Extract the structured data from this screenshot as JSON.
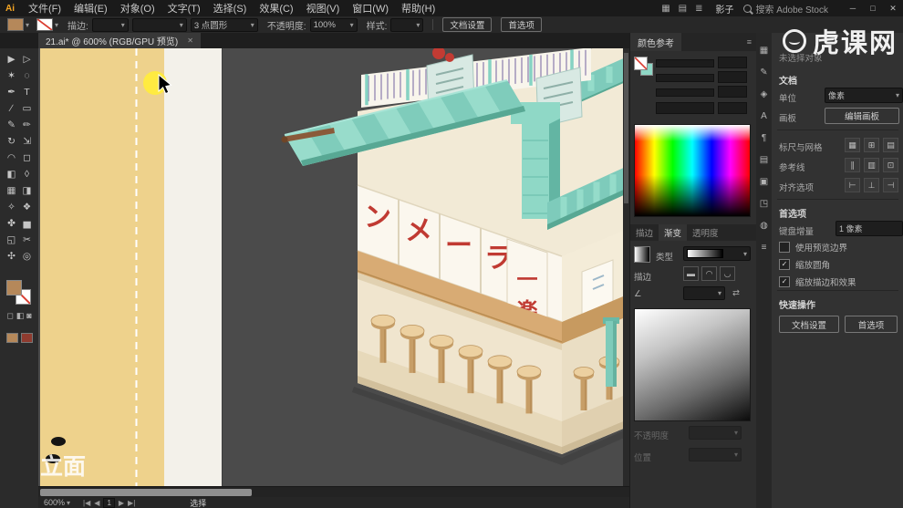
{
  "titlebar": {
    "app_logo": "Ai",
    "user": "影子",
    "search": "搜索 Adobe Stock",
    "window_controls": [
      "─",
      "□",
      "✕"
    ]
  },
  "menubar_icons": [
    {
      "name": "bridge-icon",
      "glyph": "▦"
    },
    {
      "name": "arrange-documents-icon",
      "glyph": "▤"
    },
    {
      "name": "workspace-switcher-icon",
      "glyph": "≣"
    }
  ],
  "menus": [
    "文件(F)",
    "编辑(E)",
    "对象(O)",
    "文字(T)",
    "选择(S)",
    "效果(C)",
    "视图(V)",
    "窗口(W)",
    "帮助(H)"
  ],
  "options": {
    "stroke_label": "描边:",
    "brush_value": "3 点圆形",
    "opacity_label": "不透明度:",
    "opacity_value": "100%",
    "style_label": "样式:",
    "doc_setup": "文档设置",
    "preferences": "首选项"
  },
  "doc_tab": {
    "title": "21.ai* @ 600% (RGB/GPU 预览)",
    "close": "✕"
  },
  "tools": [
    {
      "name": "selection-tool",
      "glyph": "▶"
    },
    {
      "name": "direct-selection-tool",
      "glyph": "▷"
    },
    {
      "name": "magic-wand-tool",
      "glyph": "✶"
    },
    {
      "name": "lasso-tool",
      "glyph": "◌"
    },
    {
      "name": "pen-tool",
      "glyph": "✒"
    },
    {
      "name": "type-tool",
      "glyph": "T"
    },
    {
      "name": "line-segment-tool",
      "glyph": "∕"
    },
    {
      "name": "rectangle-tool",
      "glyph": "▭"
    },
    {
      "name": "paintbrush-tool",
      "glyph": "✎"
    },
    {
      "name": "pencil-tool",
      "glyph": "✏"
    },
    {
      "name": "rotate-tool",
      "glyph": "↻"
    },
    {
      "name": "scale-tool",
      "glyph": "⇲"
    },
    {
      "name": "width-tool",
      "glyph": "◠"
    },
    {
      "name": "free-transform-tool",
      "glyph": "◻"
    },
    {
      "name": "shape-builder-tool",
      "glyph": "◧"
    },
    {
      "name": "perspective-grid-tool",
      "glyph": "◊"
    },
    {
      "name": "mesh-tool",
      "glyph": "▦"
    },
    {
      "name": "gradient-tool",
      "glyph": "◨"
    },
    {
      "name": "eyedropper-tool",
      "glyph": "✧"
    },
    {
      "name": "blend-tool",
      "glyph": "❖"
    },
    {
      "name": "symbol-sprayer-tool",
      "glyph": "✤"
    },
    {
      "name": "column-graph-tool",
      "glyph": "▅"
    },
    {
      "name": "artboard-tool",
      "glyph": "◱"
    },
    {
      "name": "slice-tool",
      "glyph": "✂"
    },
    {
      "name": "hand-tool",
      "glyph": "✣"
    },
    {
      "name": "zoom-tool",
      "glyph": "◎"
    }
  ],
  "toolbar_extra": [
    {
      "name": "draw-normal-mode-icon",
      "glyph": "◻"
    },
    {
      "name": "draw-behind-mode-icon",
      "glyph": "◧"
    },
    {
      "name": "screen-mode-icon",
      "glyph": "◙"
    }
  ],
  "canvas": {
    "signs": [
      "ン",
      "メ",
      "ー",
      "ラ"
    ],
    "corner_sign": [
      "一",
      "楽"
    ],
    "overlay_label": "立面"
  },
  "statusbar": {
    "zoom": "600%",
    "nav": [
      "|◀",
      "◀",
      "1",
      "▶",
      "▶|"
    ],
    "tool": "选择"
  },
  "color_panel": {
    "tab": "颜色参考"
  },
  "gradient_panel": {
    "tabs": [
      "描边",
      "渐变",
      "透明度"
    ],
    "type_label": "类型",
    "stroke_label": "描边",
    "stroke_icons": [
      {
        "name": "gradient-within-stroke-icon",
        "glyph": "▬"
      },
      {
        "name": "gradient-along-stroke-icon",
        "glyph": "◠"
      },
      {
        "name": "gradient-across-stroke-icon",
        "glyph": "◡"
      }
    ],
    "opacity_label": "不透明度",
    "location_label": "位置"
  },
  "dock_icons": [
    {
      "name": "swatches-panel-icon",
      "glyph": "▦"
    },
    {
      "name": "brushes-panel-icon",
      "glyph": "✎"
    },
    {
      "name": "symbols-panel-icon",
      "glyph": "◈"
    },
    {
      "name": "character-panel-icon",
      "glyph": "A"
    },
    {
      "name": "paragraph-panel-icon",
      "glyph": "¶"
    },
    {
      "name": "layers-panel-icon",
      "glyph": "▤"
    },
    {
      "name": "artboards-panel-icon",
      "glyph": "▣"
    },
    {
      "name": "transform-panel-icon",
      "glyph": "◳"
    },
    {
      "name": "appearance-panel-icon",
      "glyph": "◍"
    },
    {
      "name": "libraries-panel-icon",
      "glyph": "≡"
    }
  ],
  "properties_panel": {
    "no_selection": "未选择对象",
    "document_section": "文档",
    "units_label": "单位",
    "units_value": "像素",
    "artboard_label": "画板",
    "edit_artboards": "编辑画板",
    "rulers_label": "标尺与网格",
    "rulers_icons": [
      {
        "name": "show-rulers-icon",
        "glyph": "▦"
      },
      {
        "name": "show-grid-icon",
        "glyph": "⊞"
      },
      {
        "name": "snap-to-grid-icon",
        "glyph": "▤"
      }
    ],
    "guides_label": "参考线",
    "guides_icons": [
      {
        "name": "show-guides-icon",
        "glyph": "∥"
      },
      {
        "name": "lock-guides-icon",
        "glyph": "▥"
      },
      {
        "name": "guide-options-icon",
        "glyph": "⊡"
      }
    ],
    "snap_label": "对齐选项",
    "snap_icons": [
      {
        "name": "align-left-icon",
        "glyph": "⊢"
      },
      {
        "name": "align-center-icon",
        "glyph": "⊥"
      },
      {
        "name": "align-right-icon",
        "glyph": "⊣"
      }
    ],
    "prefs_section": "首选项",
    "keyboard_label": "键盘增量",
    "keyboard_value": "1 像素",
    "checkboxes": [
      {
        "label": "使用预览边界",
        "checked": false
      },
      {
        "label": "缩放圆角",
        "checked": true
      },
      {
        "label": "缩放描边和效果",
        "checked": true
      }
    ],
    "quick_section": "快速操作",
    "quick_doc_setup": "文档设置",
    "quick_preferences": "首选项"
  },
  "watermark": {
    "text": "虎课网"
  },
  "icons": {
    "caret": "▾",
    "menu": "≡",
    "check": "✓",
    "reverse": "⇄",
    "angle": "∠",
    "collapse": "«"
  },
  "colors": {
    "teal": "#8fd8c6",
    "teal_dark": "#58a894",
    "cream": "#f2ead6",
    "yellow": "#eed28c",
    "sign_red": "#c03a32",
    "wood_beam": "#d8ab74",
    "canvas_gray": "#4b4b4b",
    "highlight_yellow": "#ffec3d"
  }
}
